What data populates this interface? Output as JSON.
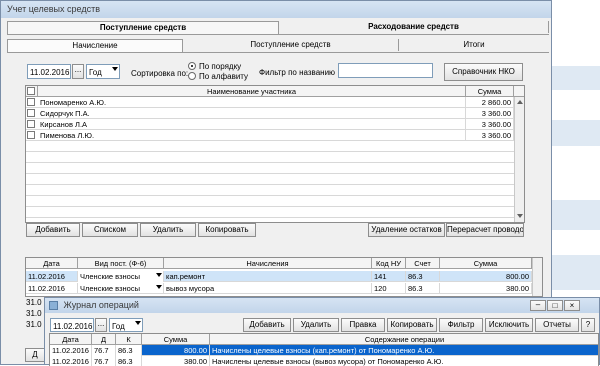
{
  "main_window": {
    "title": "Учет целевых средств",
    "section_tabs": [
      "Поступление средств",
      "Расходование средств"
    ],
    "sub_tabs": [
      "Начисление",
      "Поступление средств",
      "Итоги"
    ]
  },
  "filters": {
    "date": "11.02.2016",
    "period": "Год",
    "sort_label": "Сортировка по:",
    "sort_options": [
      "По порядку",
      "По алфавиту"
    ],
    "sort_selected": "По порядку",
    "name_filter_label": "Фильтр по названию",
    "name_filter_value": "",
    "nko_button": "Справочник НКО"
  },
  "participants": {
    "columns": [
      "Наименование участника",
      "Сумма"
    ],
    "rows": [
      {
        "name": "Пономаренко А.Ю.",
        "sum": "2 860.00"
      },
      {
        "name": "Сидорчук П.А.",
        "sum": "3 360.00"
      },
      {
        "name": "Кирсанов Л.А",
        "sum": "3 360.00"
      },
      {
        "name": "Пименова Л.Ю.",
        "sum": "3 360.00"
      }
    ]
  },
  "action_buttons": {
    "add": "Добавить",
    "list": "Списком",
    "delete": "Удалить",
    "copy": "Копировать",
    "delete_remainders": "Удаление остатков",
    "recalc": "Перерасчет проводок"
  },
  "accruals": {
    "columns": [
      "Дата",
      "Вид пост. (Ф-6)",
      "Начисления",
      "Код НУ",
      "Счет",
      "Сумма"
    ],
    "rows": [
      {
        "date": "11.02.2016",
        "type": "Членские взносы",
        "accrual": "кап.ремонт",
        "code": "141",
        "account": "86.3",
        "sum": "800.00"
      },
      {
        "date": "11.02.2016",
        "type": "Членские взносы",
        "accrual": "вывоз мусора",
        "code": "120",
        "account": "86.3",
        "sum": "380.00"
      }
    ],
    "hidden_dates": [
      "31.0",
      "31.0",
      "31.0"
    ],
    "partial_label": "Д"
  },
  "journal": {
    "title": "Журнал операций",
    "date": "11.02.2016",
    "period": "Год",
    "buttons": [
      "Добавить",
      "Удалить",
      "Правка",
      "Копировать",
      "Фильтр",
      "Исключить",
      "Отчеты",
      "?"
    ],
    "columns": [
      "Дата",
      "Д",
      "К",
      "Сумма",
      "Содержание операции"
    ],
    "rows": [
      {
        "date": "11.02.2016",
        "debit": "76.7",
        "credit": "86.3",
        "sum": "800.00",
        "content": "Начислены целевые взносы (кап.ремонт) от Пономаренко А.Ю."
      },
      {
        "date": "11.02.2016",
        "debit": "76.7",
        "credit": "86.3",
        "sum": "380.00",
        "content": "Начислены целевые взносы (вывоз мусора) от Пономаренко А.Ю."
      }
    ]
  },
  "colors": {
    "selection": "#0a64cc",
    "highlight": "#cfe4f8",
    "background_band": "#dfe9f3"
  }
}
